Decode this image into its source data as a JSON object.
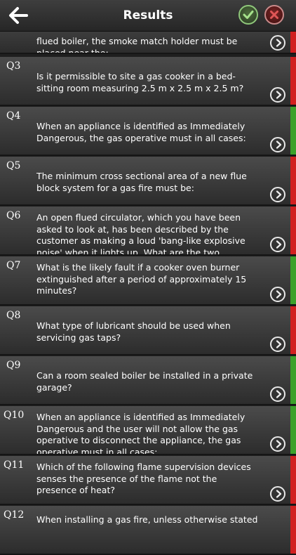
{
  "header": {
    "title": "Results",
    "back_icon": "arrow-left-icon",
    "accept_icon": "check-icon",
    "reject_icon": "close-icon",
    "accept_color": "#8fc77a",
    "reject_color": "#c0392b"
  },
  "status_colors": {
    "wrong": "#d12020",
    "correct": "#3ca12a"
  },
  "questions": [
    {
      "num": "",
      "text": "flued boiler, the smoke match holder must be placed near the:",
      "status": "wrong"
    },
    {
      "num": "Q3",
      "text": "Is it permissible to site a gas cooker in a bed-sitting room measuring 2.5 m x 2.5 m x 2.5 m?",
      "status": "wrong"
    },
    {
      "num": "Q4",
      "text": "When an appliance is identified as Immediately Dangerous, the gas operative must in all cases:",
      "status": "correct"
    },
    {
      "num": "Q5",
      "text": "The minimum cross sectional area of a new flue block system for a gas fire must be:",
      "status": "wrong"
    },
    {
      "num": "Q6",
      "text": "An open flued circulator, which you have been asked to look at, has been described by the customer as making a loud 'bang-like explosive noise' when it lights up. What are the two possible",
      "status": "wrong"
    },
    {
      "num": "Q7",
      "text": "What is the likely fault if a cooker oven burner extinguished after a period of approximately 15 minutes?",
      "status": "correct"
    },
    {
      "num": "Q8",
      "text": "What type of lubricant should be used when servicing gas taps?",
      "status": "wrong"
    },
    {
      "num": "Q9",
      "text": "Can a room sealed boiler be installed in a private garage?",
      "status": "correct"
    },
    {
      "num": "Q10",
      "text": "When an appliance is identified as Immediately Dangerous and the user will not allow the gas operative to disconnect the appliance, the gas operative must in all cases:",
      "status": "correct"
    },
    {
      "num": "Q11",
      "text": "Which of the following flame supervision devices senses the presence of the flame not the presence of heat?",
      "status": "wrong"
    },
    {
      "num": "Q12",
      "text": "When installing a gas fire, unless otherwise stated",
      "status": "wrong"
    }
  ]
}
